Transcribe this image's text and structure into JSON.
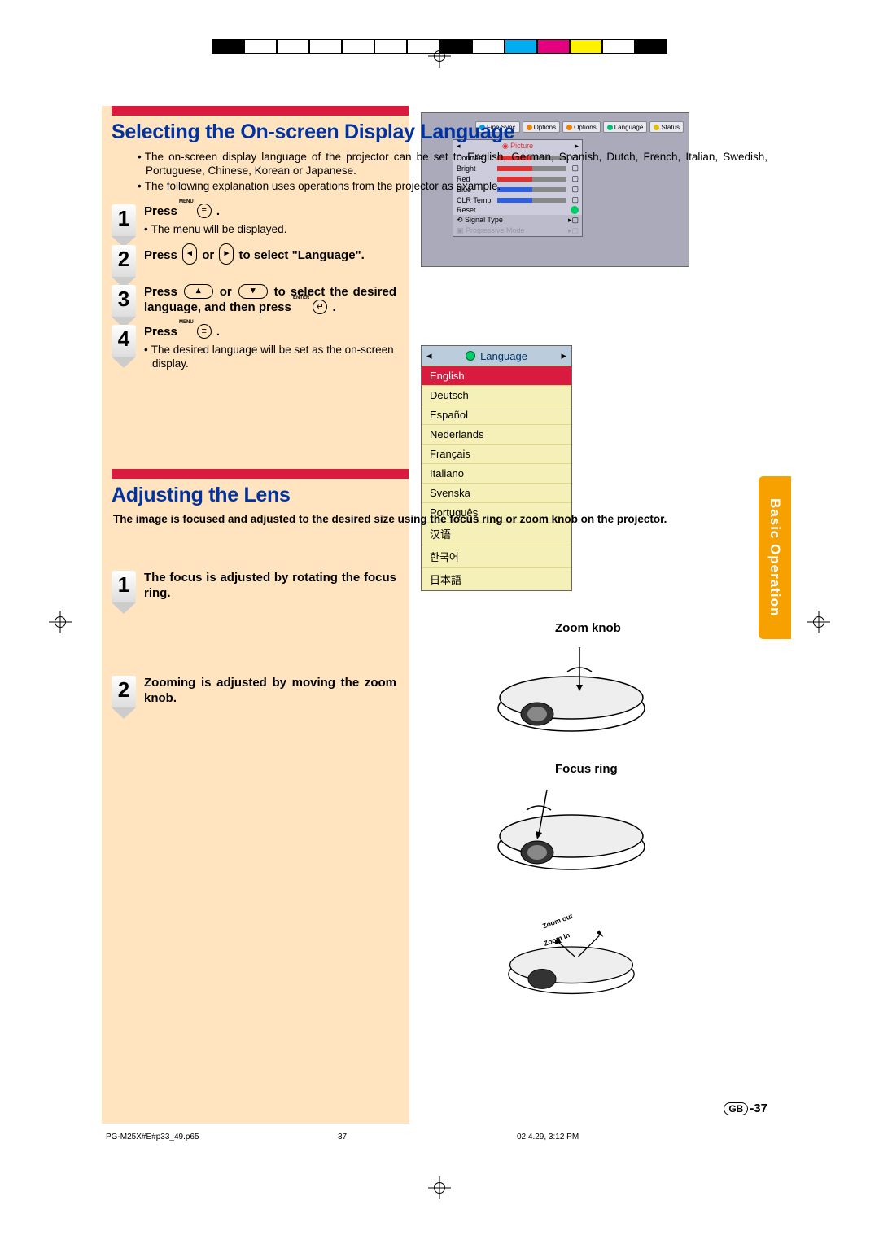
{
  "color_bar_colors": [
    "#000000",
    "#ffffff",
    "#ffffff",
    "#ffffff",
    "#ffffff",
    "#ffffff",
    "#ffffff",
    "#000000",
    "#ffffff",
    "#00aeef",
    "#e4007f",
    "#fff200",
    "#ffffff",
    "#000000"
  ],
  "section1": {
    "heading": "Selecting the On-screen Display Language",
    "bullets": [
      "The on-screen display language of the projector can be set to English, German, Spanish, Dutch, French, Italian, Swedish, Portuguese, Chinese, Korean or Japanese.",
      "The following explanation uses operations from the projector as example."
    ],
    "steps": [
      {
        "num": "1",
        "label_pre": "Press ",
        "label_post": " .",
        "sub": [
          "The menu will be displayed."
        ]
      },
      {
        "num": "2",
        "label_pre": "Press ",
        "label_mid": " or ",
        "label_post": " to select \"Language\"."
      },
      {
        "num": "3",
        "label_pre": "Press ",
        "label_mid": " or ",
        "label_post": " to select the desired language, and then press ",
        "label_end": " ."
      },
      {
        "num": "4",
        "label_pre": "Press ",
        "label_post": " .",
        "sub": [
          "The desired language will be set as the on-screen display."
        ]
      }
    ]
  },
  "section2": {
    "heading": "Adjusting the Lens",
    "intro": "The image is focused and adjusted to the desired size using the focus ring or zoom knob on the projector.",
    "steps": [
      {
        "num": "1",
        "text": "The focus is adjusted by rotating the focus ring."
      },
      {
        "num": "2",
        "text": "Zooming is adjusted  by moving the zoom knob."
      }
    ]
  },
  "osd_menu": {
    "tabs": [
      "Fine Sync",
      "Options",
      "Options",
      "Language",
      "Status"
    ],
    "tab_colors": [
      "#00a0e0",
      "#f08000",
      "#f08000",
      "#00c070",
      "#e0c000"
    ],
    "panel_title": "Picture",
    "rows": [
      {
        "label": "Contrast",
        "fill": 50,
        "color": "#e03030"
      },
      {
        "label": "Bright",
        "fill": 50,
        "color": "#e03030"
      },
      {
        "label": "Red",
        "fill": 50,
        "color": "#e03030"
      },
      {
        "label": "Blue",
        "fill": 50,
        "color": "#3060e0"
      },
      {
        "label": "CLR Temp",
        "fill": 50,
        "color": "#3060e0"
      }
    ],
    "reset": "Reset",
    "signal": "Signal Type",
    "prog": "Progressive Mode"
  },
  "lang_menu": {
    "title": "Language",
    "items": [
      "English",
      "Deutsch",
      "Español",
      "Nederlands",
      "Français",
      "Italiano",
      "Svenska",
      "Português",
      "汉语",
      "한국어",
      "日本語"
    ]
  },
  "callouts": {
    "zoom_knob": "Zoom knob",
    "focus_ring": "Focus ring",
    "zoom_out": "Zoom out",
    "zoom_in": "Zoom in"
  },
  "side_tab": "Basic Operation",
  "page_number_prefix": "GB",
  "page_number": "-37",
  "footer": {
    "file": "PG-M25X#E#p33_49.p65",
    "page": "37",
    "date": "02.4.29, 3:12 PM"
  },
  "icon_labels": {
    "menu": "MENU",
    "enter": "ENTER"
  }
}
